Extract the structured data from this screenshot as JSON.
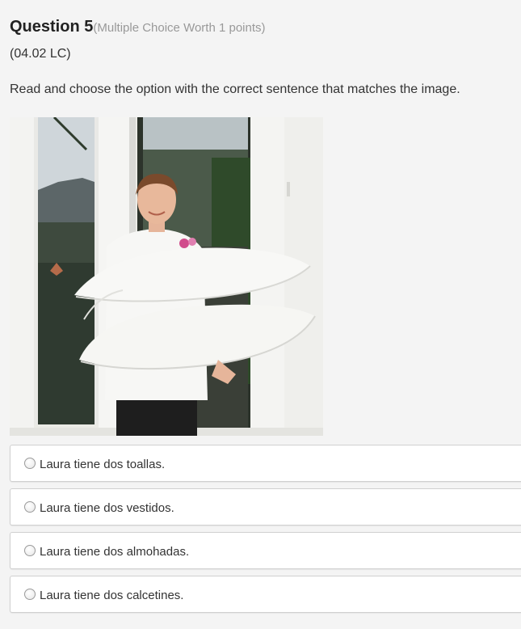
{
  "question": {
    "title": "Question 5",
    "meta": "(Multiple Choice Worth 1 points)",
    "code": "(04.02 LC)",
    "prompt": "Read and choose the option with the correct sentence that matches the image."
  },
  "choices": [
    {
      "label": "Laura tiene dos toallas."
    },
    {
      "label": "Laura tiene dos vestidos."
    },
    {
      "label": "Laura tiene dos almohadas."
    },
    {
      "label": "Laura tiene dos calcetines."
    }
  ],
  "colors": {
    "background": "#f4f4f4",
    "choice_border": "#d0d0d0",
    "meta_text": "#999999"
  },
  "icons": {
    "choice_marker": "radio-button-icon"
  }
}
